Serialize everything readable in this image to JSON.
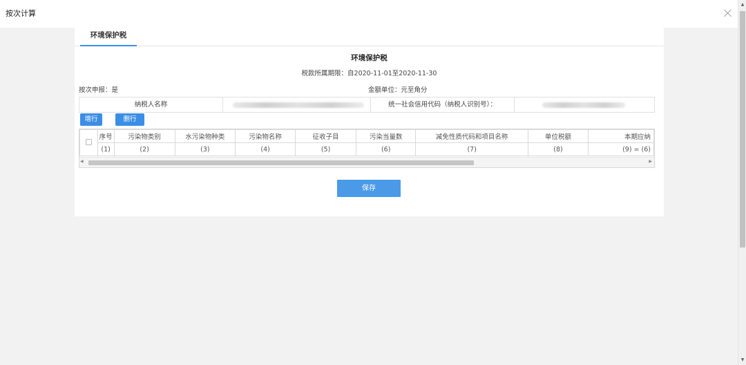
{
  "window": {
    "title": "按次计算"
  },
  "tabs": [
    {
      "label": "环境保护税"
    }
  ],
  "form": {
    "title": "环境保护税",
    "period": "税款所属期限：自2020-11-01至2020-11-30",
    "on_demand": "按次申报：是",
    "unit": "金额单位：元至角分",
    "taxpayer_name_label": "纳税人名称",
    "credit_code_label": "统一社会信用代码（纳税人识别号）："
  },
  "buttons": {
    "add_row": "增行",
    "delete_row": "删行",
    "save": "保存"
  },
  "table": {
    "headers": [
      "序号",
      "污染物类别",
      "水污染物种类",
      "污染物名称",
      "征收子目",
      "污染当量数",
      "减免性质代码和项目名称",
      "单位税额",
      "本期应纳"
    ],
    "indexes": [
      "(1)",
      "(2)",
      "(3)",
      "(4)",
      "(5)",
      "(6)",
      "(7)",
      "(8)",
      "(9) = (6)"
    ]
  }
}
